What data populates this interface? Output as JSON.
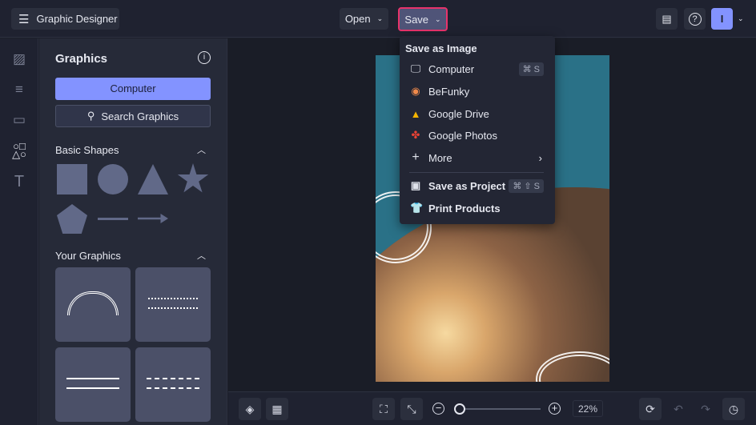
{
  "app": {
    "title": "Graphic Designer"
  },
  "header": {
    "open_label": "Open",
    "save_label": "Save",
    "avatar_initial": "I"
  },
  "panel": {
    "title": "Graphics",
    "computer_button": "Computer",
    "search_button": "Search Graphics",
    "basic_shapes": "Basic Shapes",
    "your_graphics": "Your Graphics"
  },
  "save_menu": {
    "heading": "Save as Image",
    "items": [
      {
        "label": "Computer",
        "shortcut": "⌘ S"
      },
      {
        "label": "BeFunky"
      },
      {
        "label": "Google Drive"
      },
      {
        "label": "Google Photos"
      },
      {
        "label": "More"
      }
    ],
    "project_items": [
      {
        "label": "Save as Project",
        "shortcut": "⌘ ⇧ S"
      },
      {
        "label": "Print Products"
      }
    ]
  },
  "bottom": {
    "zoom": "22%",
    "zoom_fraction": 0.22
  },
  "colors": {
    "accent": "#8393ff",
    "save_highlight": "#e8336b"
  }
}
